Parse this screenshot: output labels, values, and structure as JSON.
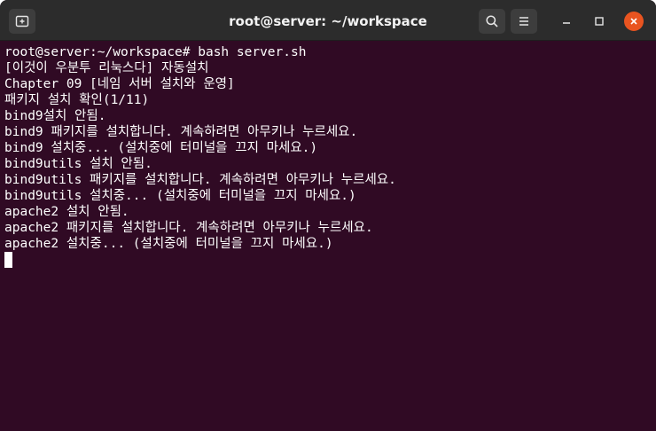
{
  "window": {
    "title": "root@server: ~/workspace"
  },
  "titlebar": {
    "new_tab_icon": "new-tab-icon",
    "search_icon": "search-icon",
    "menu_icon": "hamburger-menu-icon",
    "minimize_icon": "minimize-icon",
    "maximize_icon": "maximize-icon",
    "close_icon": "close-icon",
    "close_color": "#e95420"
  },
  "terminal": {
    "background": "#300a24",
    "foreground": "#ffffff",
    "lines": [
      "root@server:~/workspace# bash server.sh",
      "[이것이 우분투 리눅스다] 자동설치",
      "Chapter 09 [네임 서버 설치와 운영]",
      "패키지 설치 확인(1/11)",
      "bind9설치 안됨.",
      "bind9 패키지를 설치합니다. 계속하려면 아무키나 누르세요.",
      "bind9 설치중... (설치중에 터미널을 끄지 마세요.)",
      "bind9utils 설치 안됨.",
      "bind9utils 패키지를 설치합니다. 계속하려면 아무키나 누르세요.",
      "bind9utils 설치중... (설치중에 터미널을 끄지 마세요.)",
      "apache2 설치 안됨.",
      "apache2 패키지를 설치합니다. 계속하려면 아무키나 누르세요.",
      "apache2 설치중... (설치중에 터미널을 끄지 마세요.)"
    ]
  }
}
